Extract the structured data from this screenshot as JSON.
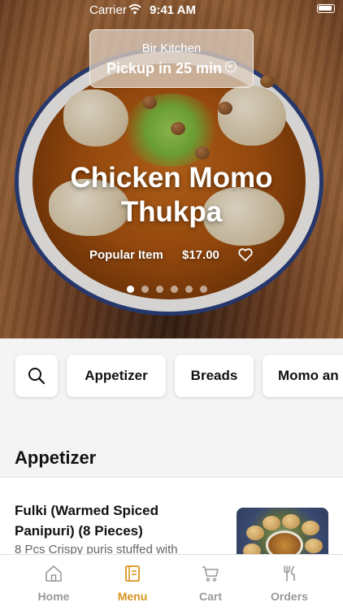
{
  "status_bar": {
    "carrier": "Carrier",
    "time": "9:41 AM"
  },
  "pickup": {
    "restaurant": "Bir Kitchen",
    "label": "Pickup in 25 min"
  },
  "hero": {
    "title_line1": "Chicken Momo",
    "title_line2": "Thukpa",
    "tag": "Popular Item",
    "price": "$17.00",
    "carousel_total": 6,
    "carousel_active": 1
  },
  "categories": [
    "Appetizer",
    "Breads",
    "Momo an"
  ],
  "section": {
    "title": "Appetizer"
  },
  "menu_item": {
    "name": "Fulki (Warmed Spiced Panipuri) (8 Pieces)",
    "description": "8 Pcs Crispy puris stuffed with"
  },
  "tabs": [
    {
      "label": "Home",
      "icon": "home-icon"
    },
    {
      "label": "Menu",
      "icon": "menu-book-icon"
    },
    {
      "label": "Cart",
      "icon": "cart-icon"
    },
    {
      "label": "Orders",
      "icon": "fork-knife-icon"
    }
  ],
  "active_tab": "Menu",
  "colors": {
    "accent": "#d9941e",
    "inactive": "#9a9a9a",
    "bowl_rim": "#2c3f7c"
  }
}
